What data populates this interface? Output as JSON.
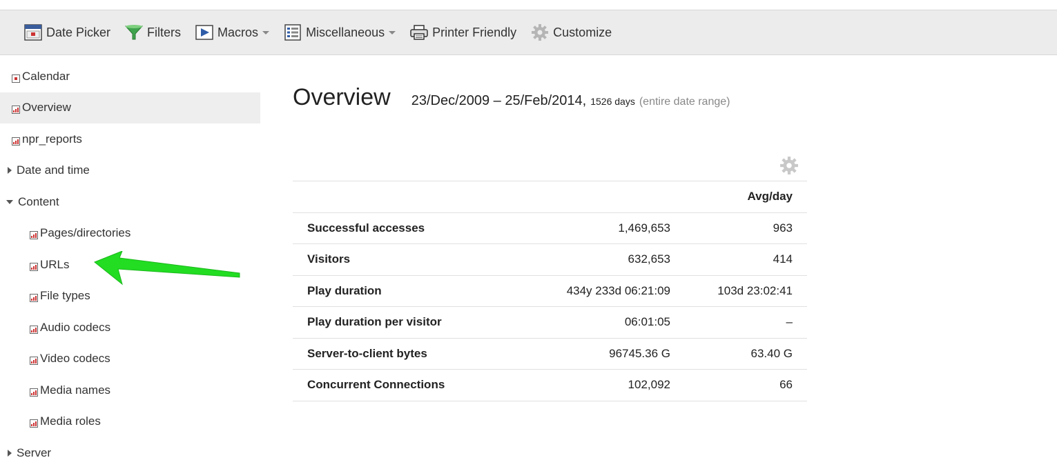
{
  "toolbar": {
    "date_picker": "Date Picker",
    "filters": "Filters",
    "macros": "Macros",
    "miscellaneous": "Miscellaneous",
    "printer_friendly": "Printer Friendly",
    "customize": "Customize"
  },
  "sidebar": {
    "calendar": "Calendar",
    "overview": "Overview",
    "npr_reports": "npr_reports",
    "date_and_time": "Date and time",
    "content": "Content",
    "content_items": [
      "Pages/directories",
      "URLs",
      "File types",
      "Audio codecs",
      "Video codecs",
      "Media names",
      "Media roles"
    ],
    "server": "Server"
  },
  "main": {
    "title": "Overview",
    "date_range": "23/Dec/2009 – 25/Feb/2014,",
    "days": "1526 days",
    "entire": "(entire date range)",
    "avg_header": "Avg/day",
    "rows": [
      {
        "label": "Successful accesses",
        "total": "1,469,653",
        "avg": "963"
      },
      {
        "label": "Visitors",
        "total": "632,653",
        "avg": "414"
      },
      {
        "label": "Play duration",
        "total": "434y 233d 06:21:09",
        "avg": "103d 23:02:41"
      },
      {
        "label": "Play duration per visitor",
        "total": "06:01:05",
        "avg": "–"
      },
      {
        "label": "Server-to-client bytes",
        "total": "96745.36 G",
        "avg": "63.40 G"
      },
      {
        "label": "Concurrent Connections",
        "total": "102,092",
        "avg": "66"
      }
    ]
  },
  "colors": {
    "arrow": "#22dd22",
    "filter_icon": "#3fa34d",
    "toolbar_bg": "#ececec",
    "active_row": "#eeeeee"
  }
}
